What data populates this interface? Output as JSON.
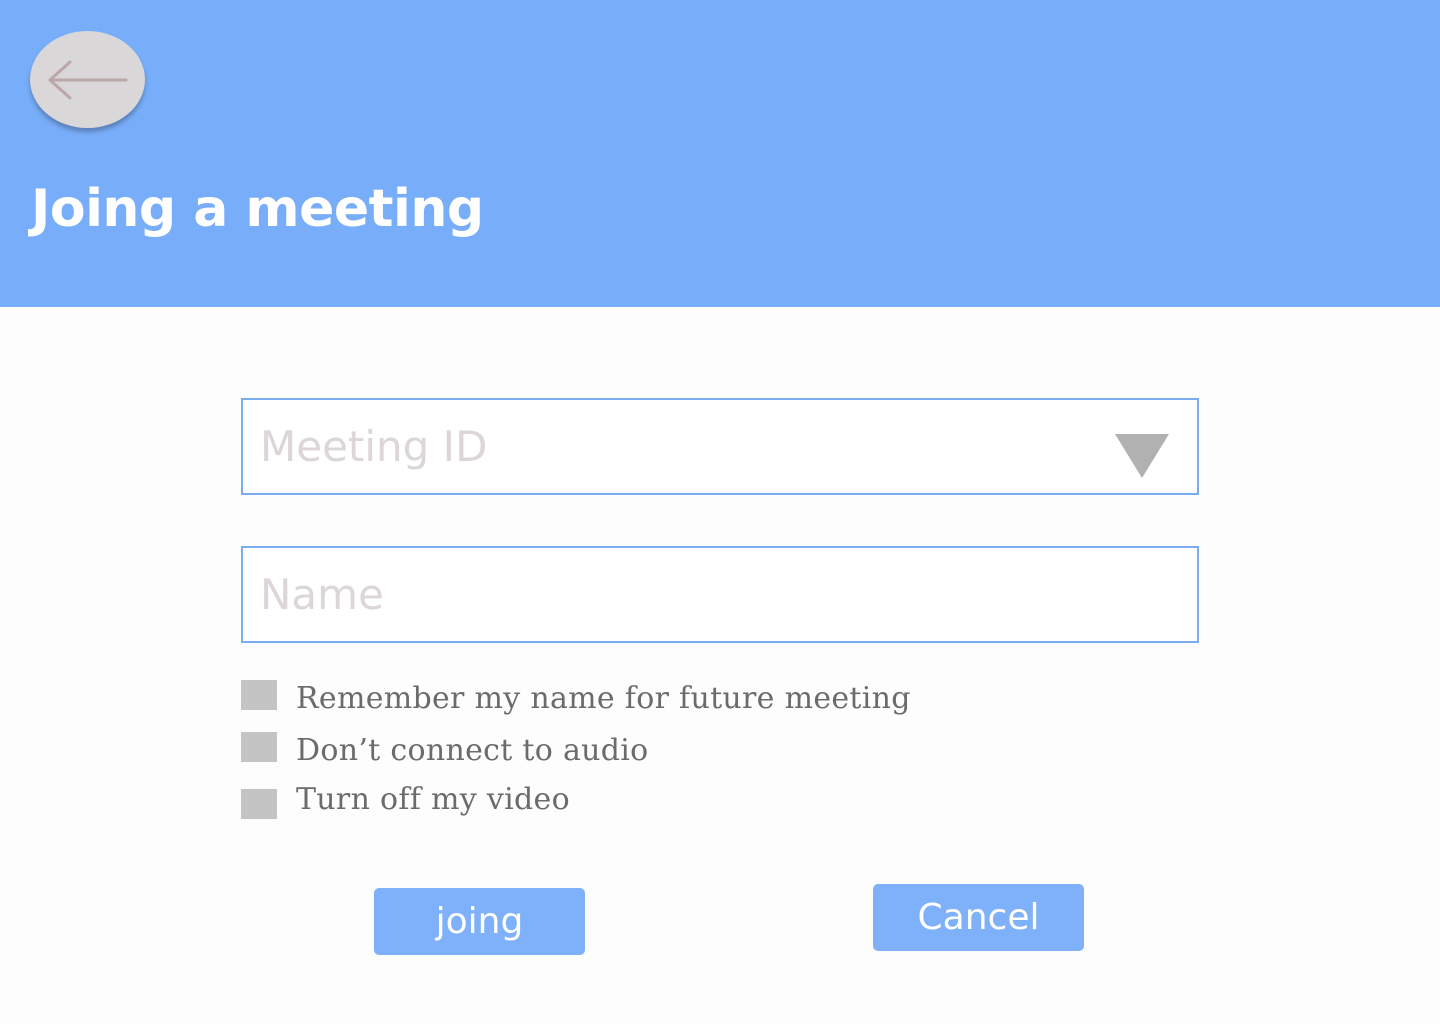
{
  "header": {
    "title": "Joing a meeting",
    "back_icon": "arrow-left-icon",
    "background": "#78adfa"
  },
  "form": {
    "meeting_id": {
      "placeholder": "Meeting ID",
      "value": "",
      "dropdown_icon": "triangle-down-icon"
    },
    "name": {
      "placeholder": "Name",
      "value": ""
    },
    "options": [
      {
        "label": "Remember my name for future meeting",
        "checked": false
      },
      {
        "label": "Don’t connect to audio",
        "checked": false
      },
      {
        "label": "Turn off my video",
        "checked": false
      }
    ]
  },
  "actions": {
    "join_label": "joing",
    "cancel_label": "Cancel"
  },
  "colors": {
    "accent": "#7fb1fa",
    "field_border": "#7aacf0",
    "checkbox": "#c4c4c4",
    "placeholder": "#dcd6d6"
  }
}
